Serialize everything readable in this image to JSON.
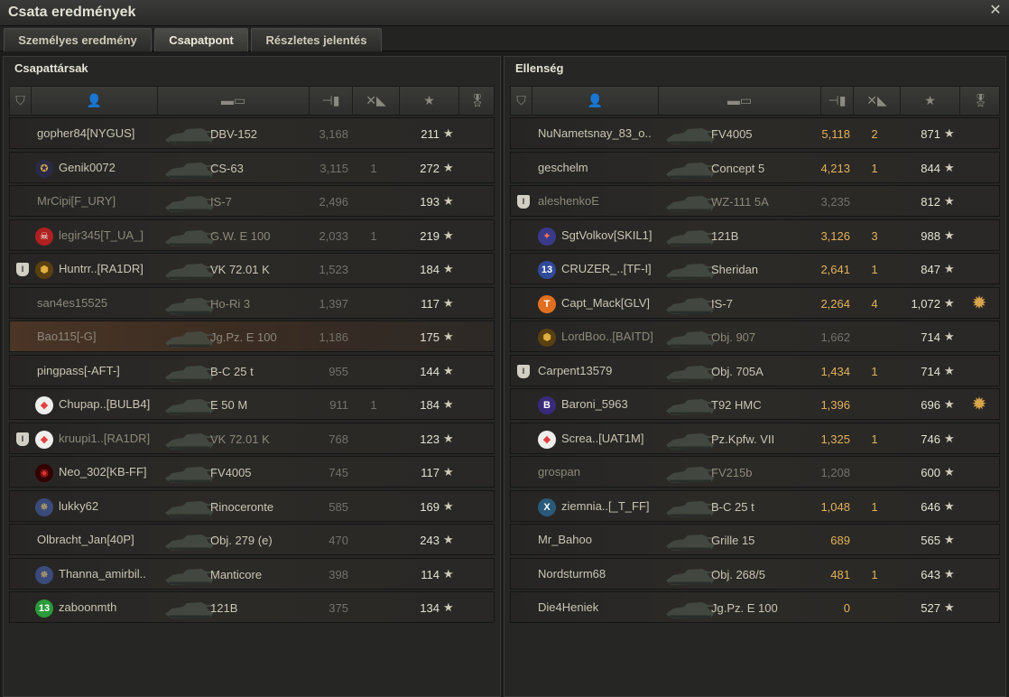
{
  "window": {
    "title": "Csata eredmények",
    "close_glyph": "✕"
  },
  "tabs": [
    {
      "label": "Személyes eredmény",
      "active": false
    },
    {
      "label": "Csapatpont",
      "active": true
    },
    {
      "label": "Részletes jelentés",
      "active": false
    }
  ],
  "left": {
    "title": "Csapattársak",
    "rows": [
      {
        "name": "gopher84[NYGUS]",
        "icon": "",
        "badge": false,
        "vehicle": "DBV-152",
        "damage": "3,168",
        "kills": "",
        "xp": "211",
        "highlight": false,
        "dim": false,
        "medal": false
      },
      {
        "name": "Genik0072",
        "icon": "clan-emblem-icon",
        "badge": false,
        "vehicle": "CS-63",
        "damage": "3,115",
        "kills": "1",
        "xp": "272",
        "highlight": false,
        "dim": false,
        "medal": false
      },
      {
        "name": "MrCipi[F_URY]",
        "icon": "",
        "badge": false,
        "vehicle": "IS-7",
        "damage": "2,496",
        "kills": "",
        "xp": "193",
        "highlight": false,
        "dim": true,
        "medal": false
      },
      {
        "name": "legir345[T_UA_]",
        "icon": "skull-clan-icon",
        "badge": false,
        "vehicle": "G.W. E 100",
        "damage": "2,033",
        "kills": "1",
        "xp": "219",
        "highlight": false,
        "dim": true,
        "medal": false
      },
      {
        "name": "Huntrr..[RA1DR]",
        "icon": "gold-tank-icon",
        "badge": true,
        "vehicle": "VK 72.01 K",
        "damage": "1,523",
        "kills": "",
        "xp": "184",
        "highlight": false,
        "dim": false,
        "medal": false
      },
      {
        "name": "san4es15525",
        "icon": "",
        "badge": false,
        "vehicle": "Ho-Ri 3",
        "damage": "1,397",
        "kills": "",
        "xp": "117",
        "highlight": false,
        "dim": true,
        "medal": false
      },
      {
        "name": "Bao115[-G]",
        "icon": "",
        "badge": false,
        "vehicle": "Jg.Pz. E 100",
        "damage": "1,186",
        "kills": "",
        "xp": "175",
        "highlight": true,
        "dim": true,
        "medal": false
      },
      {
        "name": "pingpass[-AFT-]",
        "icon": "",
        "badge": false,
        "vehicle": "B-C 25 t",
        "damage": "955",
        "kills": "",
        "xp": "144",
        "highlight": false,
        "dim": false,
        "medal": false
      },
      {
        "name": "Chupap..[BULB4]",
        "icon": "diamond-rank-icon",
        "badge": false,
        "vehicle": "E 50 M",
        "damage": "911",
        "kills": "1",
        "xp": "184",
        "highlight": false,
        "dim": false,
        "medal": false
      },
      {
        "name": "kruupi1..[RA1DR]",
        "icon": "diamond-rank-icon",
        "badge": true,
        "vehicle": "VK 72.01 K",
        "damage": "768",
        "kills": "",
        "xp": "123",
        "highlight": false,
        "dim": true,
        "medal": false
      },
      {
        "name": "Neo_302[KB-FF]",
        "icon": "red-wing-icon",
        "badge": false,
        "vehicle": "FV4005",
        "damage": "745",
        "kills": "",
        "xp": "117",
        "highlight": false,
        "dim": false,
        "medal": false
      },
      {
        "name": "lukky62",
        "icon": "wings-clan-icon",
        "badge": false,
        "vehicle": "Rinoceronte",
        "damage": "585",
        "kills": "",
        "xp": "169",
        "highlight": false,
        "dim": false,
        "medal": false
      },
      {
        "name": "Olbracht_Jan[40P]",
        "icon": "",
        "badge": false,
        "vehicle": "Obj. 279 (e)",
        "damage": "470",
        "kills": "",
        "xp": "243",
        "highlight": false,
        "dim": false,
        "medal": false
      },
      {
        "name": "Thanna_amirbil..",
        "icon": "wings-clan-icon",
        "badge": false,
        "vehicle": "Manticore",
        "damage": "398",
        "kills": "",
        "xp": "114",
        "highlight": false,
        "dim": false,
        "medal": false
      },
      {
        "name": "zaboonmth",
        "icon": "green-13-icon",
        "badge": false,
        "vehicle": "121B",
        "damage": "375",
        "kills": "",
        "xp": "134",
        "highlight": false,
        "dim": false,
        "medal": false
      }
    ]
  },
  "right": {
    "title": "Ellenség",
    "rows": [
      {
        "name": "NuNametsnay_83_o..",
        "icon": "",
        "badge": false,
        "vehicle": "FV4005",
        "damage": "5,118",
        "kills": "2",
        "xp": "871",
        "highlight": false,
        "dim": false,
        "medal": false
      },
      {
        "name": "geschelm",
        "icon": "",
        "badge": false,
        "vehicle": "Concept 5",
        "damage": "4,213",
        "kills": "1",
        "xp": "844",
        "highlight": false,
        "dim": false,
        "medal": false
      },
      {
        "name": "aleshenkoE",
        "icon": "",
        "badge": true,
        "vehicle": "WZ-111 5A",
        "damage": "3,235",
        "kills": "",
        "xp": "812",
        "highlight": false,
        "dim": true,
        "medal": false
      },
      {
        "name": "SgtVolkov[SKIL1]",
        "icon": "rank-badge-icon",
        "badge": false,
        "vehicle": "121B",
        "damage": "3,126",
        "kills": "3",
        "xp": "988",
        "highlight": false,
        "dim": false,
        "medal": false
      },
      {
        "name": "CRUZER_..[TF-I]",
        "icon": "rank-13-icon",
        "badge": false,
        "vehicle": "Sheridan",
        "damage": "2,641",
        "kills": "1",
        "xp": "847",
        "highlight": false,
        "dim": false,
        "medal": false
      },
      {
        "name": "Capt_Mack[GLV]",
        "icon": "orange-t-icon",
        "badge": false,
        "vehicle": "IS-7",
        "damage": "2,264",
        "kills": "4",
        "xp": "1,072",
        "highlight": false,
        "dim": false,
        "medal": true
      },
      {
        "name": "LordBoo..[BAITD]",
        "icon": "gold-tank-icon",
        "badge": false,
        "vehicle": "Obj. 907",
        "damage": "1,662",
        "kills": "",
        "xp": "714",
        "highlight": false,
        "dim": true,
        "medal": false
      },
      {
        "name": "Carpent13579",
        "icon": "",
        "badge": true,
        "vehicle": "Obj. 705A",
        "damage": "1,434",
        "kills": "1",
        "xp": "714",
        "highlight": false,
        "dim": false,
        "medal": false
      },
      {
        "name": "Baroni_5963",
        "icon": "b-rank-icon",
        "badge": false,
        "vehicle": "T92 HMC",
        "damage": "1,396",
        "kills": "",
        "xp": "696",
        "highlight": false,
        "dim": false,
        "medal": true
      },
      {
        "name": "Screa..[UAT1M]",
        "icon": "diamond-rank-icon",
        "badge": false,
        "vehicle": "Pz.Kpfw. VII",
        "damage": "1,325",
        "kills": "1",
        "xp": "746",
        "highlight": false,
        "dim": false,
        "medal": false
      },
      {
        "name": "grospan",
        "icon": "",
        "badge": false,
        "vehicle": "FV215b",
        "damage": "1,208",
        "kills": "",
        "xp": "600",
        "highlight": false,
        "dim": true,
        "medal": false
      },
      {
        "name": "ziemnia..[_T_FF]",
        "icon": "x-rank-icon",
        "badge": false,
        "vehicle": "B-C 25 t",
        "damage": "1,048",
        "kills": "1",
        "xp": "646",
        "highlight": false,
        "dim": false,
        "medal": false
      },
      {
        "name": "Mr_Bahoo",
        "icon": "",
        "badge": false,
        "vehicle": "Grille 15",
        "damage": "689",
        "kills": "",
        "xp": "565",
        "highlight": false,
        "dim": false,
        "medal": false
      },
      {
        "name": "Nordsturm68",
        "icon": "",
        "badge": false,
        "vehicle": "Obj. 268/5",
        "damage": "481",
        "kills": "1",
        "xp": "643",
        "highlight": false,
        "dim": false,
        "medal": false
      },
      {
        "name": "Die4Heniek",
        "icon": "",
        "badge": false,
        "vehicle": "Jg.Pz. E 100",
        "damage": "0",
        "kills": "",
        "xp": "527",
        "highlight": false,
        "dim": false,
        "medal": false
      }
    ]
  },
  "colors": {
    "damage_gold": "#e2b15a",
    "damage_gray": "#74716a",
    "medal": "#d9a44a"
  }
}
